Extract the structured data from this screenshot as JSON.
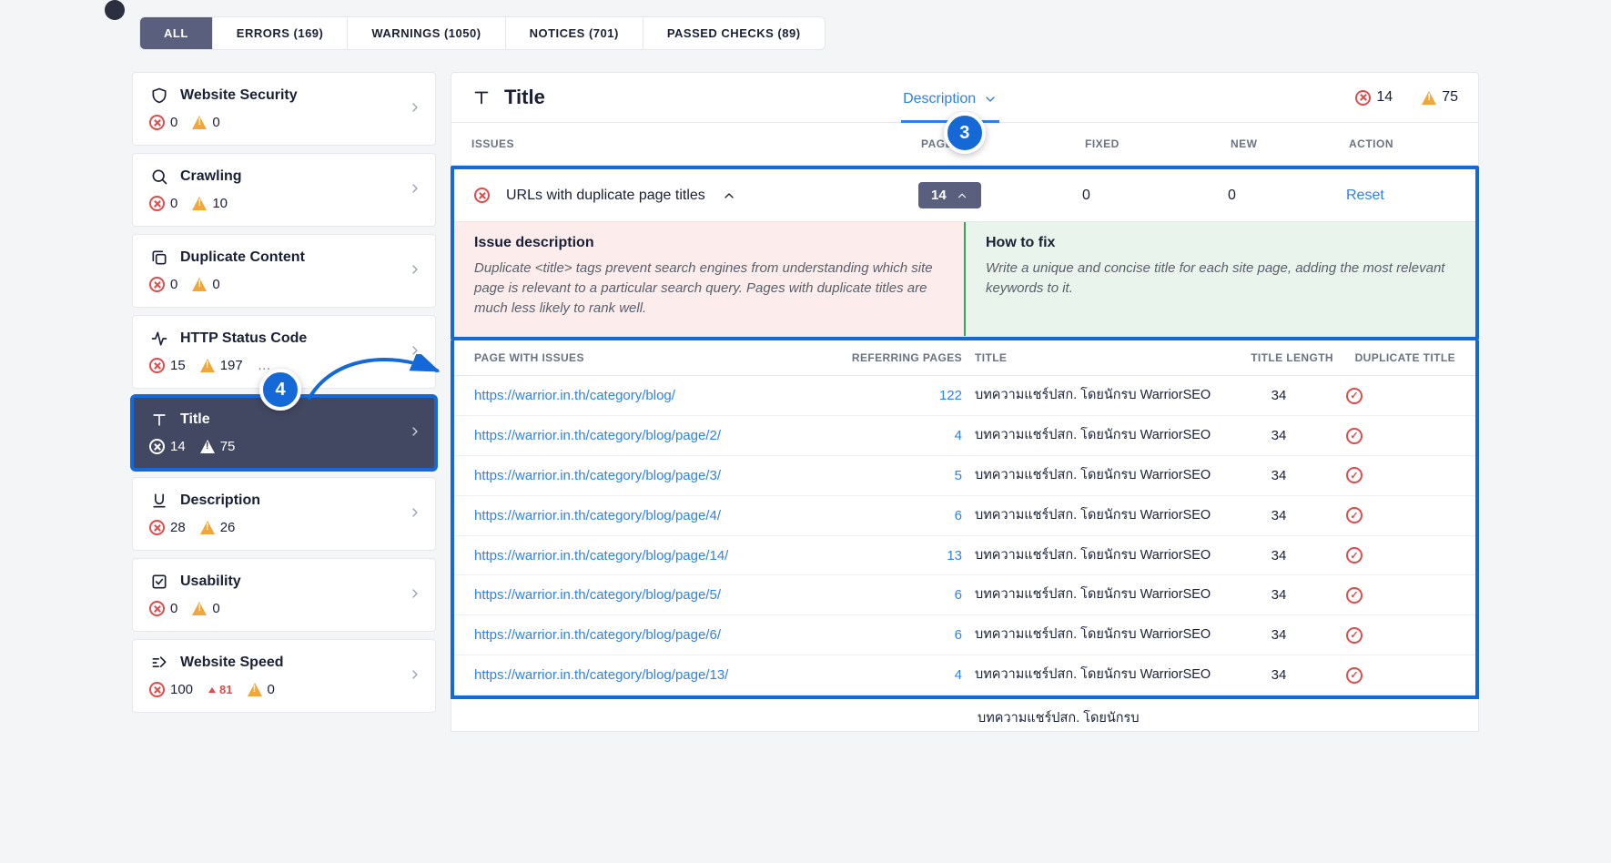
{
  "top_tabs": [
    {
      "label": "ALL",
      "active": true
    },
    {
      "label": "ERRORS (169)"
    },
    {
      "label": "WARNINGS (1050)"
    },
    {
      "label": "NOTICES (701)"
    },
    {
      "label": "PASSED CHECKS (89)"
    }
  ],
  "sidebar": [
    {
      "icon": "shield",
      "label": "Website Security",
      "err": "0",
      "warn": "0"
    },
    {
      "icon": "search",
      "label": "Crawling",
      "err": "0",
      "warn": "10"
    },
    {
      "icon": "copy",
      "label": "Duplicate Content",
      "err": "0",
      "warn": "0"
    },
    {
      "icon": "pulse",
      "label": "HTTP Status Code",
      "err": "15",
      "warn": "197",
      "warn_extra": "…"
    },
    {
      "icon": "type",
      "label": "Title",
      "err": "14",
      "warn": "75",
      "active": true
    },
    {
      "icon": "underline",
      "label": "Description",
      "err": "28",
      "warn": "26"
    },
    {
      "icon": "check-sq",
      "label": "Usability",
      "err": "0",
      "warn": "0"
    },
    {
      "icon": "speed",
      "label": "Website Speed",
      "err": "100",
      "delta": "81",
      "warn": "0"
    }
  ],
  "main": {
    "title": "Title",
    "tab": "Description",
    "head_err": "14",
    "head_warn": "75",
    "columns": {
      "issues": "ISSUES",
      "pages": "PAGES",
      "fixed": "FIXED",
      "new": "NEW",
      "action": "ACTION"
    },
    "issue": {
      "name": "URLs with duplicate page titles",
      "pages": "14",
      "fixed": "0",
      "new": "0",
      "action": "Reset"
    },
    "desc": {
      "left_h": "Issue description",
      "left_p": "Duplicate <title> tags prevent search engines from understanding which site page is relevant to a particular search query. Pages with duplicate titles are much less likely to rank well.",
      "right_h": "How to fix",
      "right_p": "Write a unique and concise title for each site page, adding the most relevant keywords to it."
    },
    "sub_cols": {
      "page": "PAGE WITH ISSUES",
      "ref": "REFERRING PAGES",
      "title": "TITLE",
      "len": "TITLE LENGTH",
      "dup": "DUPLICATE TITLE"
    },
    "rows": [
      {
        "url": "https://warrior.in.th/category/blog/",
        "ref": "122",
        "title": "บทความแชร์ปสก. โดยนักรบ WarriorSEO",
        "len": "34"
      },
      {
        "url": "https://warrior.in.th/category/blog/page/2/",
        "ref": "4",
        "title": "บทความแชร์ปสก. โดยนักรบ WarriorSEO",
        "len": "34"
      },
      {
        "url": "https://warrior.in.th/category/blog/page/3/",
        "ref": "5",
        "title": "บทความแชร์ปสก. โดยนักรบ WarriorSEO",
        "len": "34"
      },
      {
        "url": "https://warrior.in.th/category/blog/page/4/",
        "ref": "6",
        "title": "บทความแชร์ปสก. โดยนักรบ WarriorSEO",
        "len": "34"
      },
      {
        "url": "https://warrior.in.th/category/blog/page/14/",
        "ref": "13",
        "title": "บทความแชร์ปสก. โดยนักรบ WarriorSEO",
        "len": "34"
      },
      {
        "url": "https://warrior.in.th/category/blog/page/5/",
        "ref": "6",
        "title": "บทความแชร์ปสก. โดยนักรบ WarriorSEO",
        "len": "34"
      },
      {
        "url": "https://warrior.in.th/category/blog/page/6/",
        "ref": "6",
        "title": "บทความแชร์ปสก. โดยนักรบ WarriorSEO",
        "len": "34"
      },
      {
        "url": "https://warrior.in.th/category/blog/page/13/",
        "ref": "4",
        "title": "บทความแชร์ปสก. โดยนักรบ WarriorSEO",
        "len": "34"
      }
    ],
    "tail_title": "บทความแชร์ปสก. โดยนักรบ"
  },
  "steps": {
    "three": "3",
    "four": "4"
  }
}
